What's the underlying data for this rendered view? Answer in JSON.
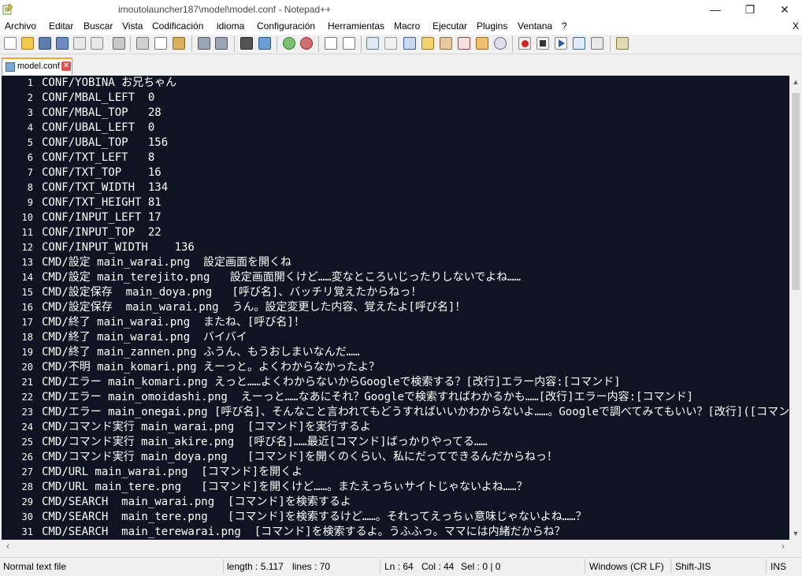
{
  "window": {
    "title": "imoutolauncher187\\model\\model.conf - Notepad++",
    "buttons": {
      "minimize": "—",
      "maximize": "❐",
      "close": "✕"
    }
  },
  "menu": {
    "items": [
      "Archivo",
      "Editar",
      "Buscar",
      "Vista",
      "Codificación",
      "idioma",
      "Configuración",
      "Herramientas",
      "Macro",
      "Ejecutar",
      "Plugins",
      "Ventana",
      "?"
    ],
    "close_x": "X"
  },
  "toolbar": {
    "icons": [
      "new-file-icon",
      "open-file-icon",
      "save-icon",
      "save-all-icon",
      "close-icon",
      "close-all-icon",
      "print-icon",
      "cut-icon",
      "copy-icon",
      "paste-icon",
      "undo-icon",
      "redo-icon",
      "find-icon",
      "replace-icon",
      "zoom-in-icon",
      "zoom-out-icon",
      "sync-vertical-icon",
      "sync-horizontal-icon",
      "word-wrap-icon",
      "show-all-chars-icon",
      "indent-guide-icon",
      "user-language-icon",
      "document-map-icon",
      "function-list-icon",
      "folder-as-workspace-icon",
      "monitoring-icon",
      "record-macro-icon",
      "stop-macro-icon",
      "play-macro-icon",
      "run-macro-multiple-icon",
      "save-macro-icon",
      "launch-browser-icon"
    ]
  },
  "tab": {
    "label": "model.conf"
  },
  "editor": {
    "lines": [
      {
        "n": "1",
        "t": "CONF/YOBINA お兄ちゃん"
      },
      {
        "n": "2",
        "t": "CONF/MBAL_LEFT  0"
      },
      {
        "n": "3",
        "t": "CONF/MBAL_TOP   28"
      },
      {
        "n": "4",
        "t": "CONF/UBAL_LEFT  0"
      },
      {
        "n": "5",
        "t": "CONF/UBAL_TOP   156"
      },
      {
        "n": "6",
        "t": "CONF/TXT_LEFT   8"
      },
      {
        "n": "7",
        "t": "CONF/TXT_TOP    16"
      },
      {
        "n": "8",
        "t": "CONF/TXT_WIDTH  134"
      },
      {
        "n": "9",
        "t": "CONF/TXT_HEIGHT 81"
      },
      {
        "n": "10",
        "t": "CONF/INPUT_LEFT 17"
      },
      {
        "n": "11",
        "t": "CONF/INPUT_TOP  22"
      },
      {
        "n": "12",
        "t": "CONF/INPUT_WIDTH    136"
      },
      {
        "n": "13",
        "t": "CMD/設定 main_warai.png  設定画面を開くね"
      },
      {
        "n": "14",
        "t": "CMD/設定 main_terejito.png   設定画面開くけど……変なところいじったりしないでよね……"
      },
      {
        "n": "15",
        "t": "CMD/設定保存  main_doya.png   [呼び名]、バッチリ覚えたからねっ！"
      },
      {
        "n": "16",
        "t": "CMD/設定保存  main_warai.png  うん。設定変更した内容、覚えたよ[呼び名]！"
      },
      {
        "n": "17",
        "t": "CMD/終了 main_warai.png  またね、[呼び名]！"
      },
      {
        "n": "18",
        "t": "CMD/終了 main_warai.png  バイバイ"
      },
      {
        "n": "19",
        "t": "CMD/終了 main_zannen.png ふうん、もうおしまいなんだ……"
      },
      {
        "n": "20",
        "t": "CMD/不明 main_komari.png えーっと。よくわからなかったよ？"
      },
      {
        "n": "21",
        "t": "CMD/エラー main_komari.png えっと……よくわからないからGoogleで検索する？[改行]エラー内容:[コマンド]"
      },
      {
        "n": "22",
        "t": "CMD/エラー main_omoidashi.png  えーっと……なあにそれ？Googleで検索すればわかるかも……[改行]エラー内容:[コマンド]"
      },
      {
        "n": "23",
        "t": "CMD/エラー main_onegai.png [呼び名]、そんなこと言われてもどうすればいいかわからないよ……。Googleで調べてみてもいい？[改行]([コマンド])"
      },
      {
        "n": "24",
        "t": "CMD/コマンド実行 main_warai.png  [コマンド]を実行するよ"
      },
      {
        "n": "25",
        "t": "CMD/コマンド実行 main_akire.png  [呼び名]……最近[コマンド]ばっかりやってる……"
      },
      {
        "n": "26",
        "t": "CMD/コマンド実行 main_doya.png   [コマンド]を開くのくらい、私にだってできるんだからねっ！"
      },
      {
        "n": "27",
        "t": "CMD/URL main_warai.png  [コマンド]を開くよ"
      },
      {
        "n": "28",
        "t": "CMD/URL main_tere.png   [コマンド]を開くけど……。またえっちぃサイトじゃないよね……？"
      },
      {
        "n": "29",
        "t": "CMD/SEARCH  main_warai.png  [コマンド]を検索するよ"
      },
      {
        "n": "30",
        "t": "CMD/SEARCH  main_tere.png   [コマンド]を検索するけど……。それってえっちぃ意味じゃないよね……？"
      },
      {
        "n": "31",
        "t": "CMD/SEARCH  main_terewarai.png  [コマンド]を検索するよ。うふふっ。ママには内緒だからね？"
      }
    ]
  },
  "status": {
    "type": "Normal text file",
    "length": "length : 5.117",
    "lines": "lines : 70",
    "ln": "Ln : 64",
    "col": "Col : 44",
    "sel": "Sel : 0 | 0",
    "eol": "Windows (CR LF)",
    "encoding": "Shift-JIS",
    "mode": "INS"
  },
  "colors": {
    "editor_bg": "#0f1422",
    "editor_fg": "#ffffff",
    "tab_accent": "#f5a623"
  }
}
